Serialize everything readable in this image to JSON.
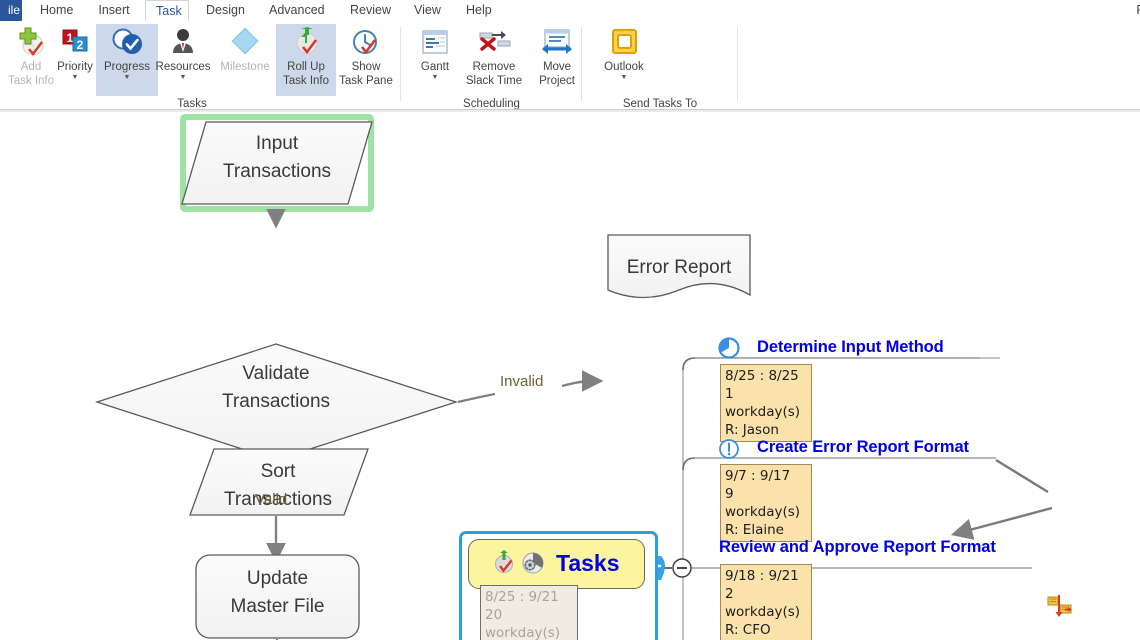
{
  "window": {
    "app_title_fragment": "F"
  },
  "ribbon": {
    "file_tab": "ile",
    "tabs": [
      {
        "label": "Home",
        "active": false
      },
      {
        "label": "Insert",
        "active": false
      },
      {
        "label": "Task",
        "active": true
      },
      {
        "label": "Design",
        "active": false
      },
      {
        "label": "Advanced",
        "active": false
      },
      {
        "label": "Review",
        "active": false
      },
      {
        "label": "View",
        "active": false
      },
      {
        "label": "Help",
        "active": false
      }
    ],
    "groups": [
      {
        "name": "Tasks",
        "label": "Tasks",
        "buttons": [
          {
            "id": "add-task-info",
            "line1": "Add",
            "line2": "Task Info",
            "icon": "add-task-info-icon",
            "dimmed": true,
            "caret": false,
            "selected": false
          },
          {
            "id": "priority",
            "line1": "Priority",
            "line2": "",
            "icon": "priority-icon",
            "dimmed": false,
            "caret": true,
            "selected": false
          },
          {
            "id": "progress",
            "line1": "Progress",
            "line2": "",
            "icon": "progress-icon",
            "dimmed": false,
            "caret": true,
            "selected": true
          },
          {
            "id": "resources",
            "line1": "Resources",
            "line2": "",
            "icon": "resources-icon",
            "dimmed": false,
            "caret": true,
            "selected": false
          },
          {
            "id": "milestone",
            "line1": "Milestone",
            "line2": "",
            "icon": "milestone-icon",
            "dimmed": true,
            "caret": false,
            "selected": false
          },
          {
            "id": "roll-up-task-info",
            "line1": "Roll Up",
            "line2": "Task Info",
            "icon": "roll-up-icon",
            "dimmed": false,
            "caret": false,
            "selected": true
          },
          {
            "id": "show-task-pane",
            "line1": "Show",
            "line2": "Task Pane",
            "icon": "show-task-pane-icon",
            "dimmed": false,
            "caret": false,
            "selected": false
          }
        ]
      },
      {
        "name": "Scheduling",
        "label": "Scheduling",
        "buttons": [
          {
            "id": "gantt",
            "line1": "Gantt",
            "line2": "",
            "icon": "gantt-icon",
            "dimmed": false,
            "caret": true,
            "selected": false
          },
          {
            "id": "remove-slack",
            "line1": "Remove",
            "line2": "Slack Time",
            "icon": "remove-slack-icon",
            "dimmed": false,
            "caret": true,
            "selected": false
          },
          {
            "id": "move-project",
            "line1": "Move",
            "line2": "Project",
            "icon": "move-project-icon",
            "dimmed": false,
            "caret": false,
            "selected": false
          }
        ]
      },
      {
        "name": "Send Tasks To",
        "label": "Send Tasks To",
        "buttons": [
          {
            "id": "outlook",
            "line1": "Outlook",
            "line2": "",
            "icon": "outlook-icon",
            "dimmed": false,
            "caret": true,
            "selected": false
          }
        ]
      }
    ]
  },
  "diagram": {
    "flow_shapes": [
      {
        "id": "input-transactions",
        "line1": "Input",
        "line2": "Transactions",
        "shape": "parallelogram",
        "selected": true
      },
      {
        "id": "validate-transactions",
        "line1": "Validate",
        "line2": "Transactions",
        "shape": "diamond",
        "selected": false
      },
      {
        "id": "error-report",
        "line1": "Error Report",
        "line2": "",
        "shape": "document",
        "selected": false
      },
      {
        "id": "sort-transactions",
        "line1": "Sort",
        "line2": "Transactions",
        "shape": "parallelogram",
        "selected": false
      },
      {
        "id": "update-master-file",
        "line1": "Update",
        "line2": "Master File",
        "shape": "rounded-rect",
        "selected": false
      }
    ],
    "edge_labels": [
      {
        "id": "invalid-label",
        "text": "Invalid"
      },
      {
        "id": "valid-label",
        "text": "Valid"
      }
    ]
  },
  "mindmap": {
    "center": {
      "title": "Tasks",
      "callout": "8/25 : 9/21\n20 workday(s)",
      "callout_line1": "8/25 : 9/21",
      "callout_line2": "20 workday(s)",
      "icons": [
        "roll-up-task-info-icon",
        "progress-pie-icon"
      ],
      "selected": true,
      "expand_label": "+",
      "collapse_label": "−"
    },
    "nodes": [
      {
        "id": "determine-input-method",
        "title": "Determine Input Method",
        "icon": "progress-pie-icon",
        "line1": "8/25 : 8/25",
        "line2": "1 workday(s)",
        "line3": "R: Jason"
      },
      {
        "id": "create-error-report-format",
        "title": "Create Error Report Format",
        "icon": "priority-alert-icon",
        "line1": "9/7 : 9/17",
        "line2": "9 workday(s)",
        "line3": "R: Elaine"
      },
      {
        "id": "review-and-approve-report-format",
        "title": "Review and Approve Report Format",
        "icon": "none",
        "line1": "9/18 : 9/21",
        "line2": "2 workday(s)",
        "line3": "R: CFO"
      }
    ],
    "link_marker": {
      "id": "finish-to-start-link-icon"
    }
  },
  "colors": {
    "accent_blue": "#2b579a",
    "selection_blue": "#2a9fe0",
    "selection_green": "#9fe3a4",
    "title_blue": "#0000e0",
    "callout_fill": "#fbe2ab",
    "tasks_fill": "#fbf5a0",
    "edge_label": "#6b6036",
    "ribbon_selected": "#cdd9ea"
  }
}
